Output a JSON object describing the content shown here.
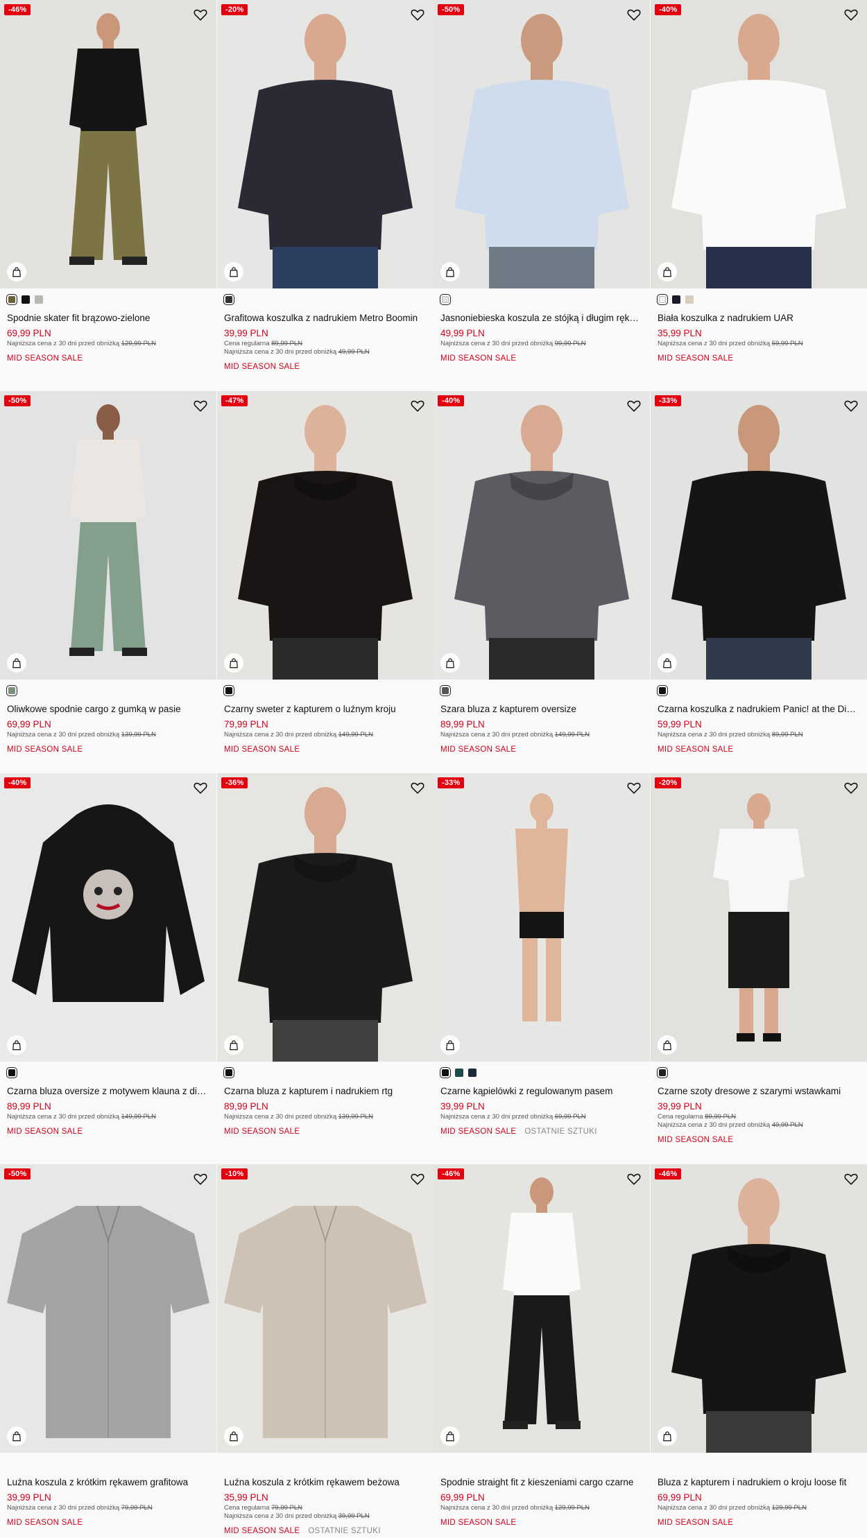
{
  "sale_tag": "MID SEASON SALE",
  "last_items_tag": "OSTATNIE SZTUKI",
  "regular_label": "Cena regularna",
  "lowest_label": "Najniższa cena z 30 dni przed obniżką",
  "products": [
    {
      "badge": "-46%",
      "name": "Spodnie skater fit brązowo-zielone",
      "price": "69,99 PLN",
      "regular": "",
      "lowest": "129,99 PLN",
      "last": false,
      "swatches": [
        "#6b6438",
        "#111111",
        "#b8b8b0"
      ]
    },
    {
      "badge": "-20%",
      "name": "Grafitowa koszulka z nadrukiem Metro Boomin",
      "price": "39,99 PLN",
      "regular": "89,99 PLN",
      "lowest": "49,99 PLN",
      "last": false,
      "swatches": [
        "#333333"
      ]
    },
    {
      "badge": "-50%",
      "name": "Jasnoniebieska koszula ze stójką i długim rękawem",
      "price": "49,99 PLN",
      "regular": "",
      "lowest": "99,99 PLN",
      "last": false,
      "swatches": [
        "#dfe4ec"
      ]
    },
    {
      "badge": "-40%",
      "name": "Biała koszulka z nadrukiem UAR",
      "price": "35,99 PLN",
      "regular": "",
      "lowest": "59,99 PLN",
      "last": false,
      "swatches": [
        "#f2f2f2",
        "#1a1a2a",
        "#d9cbbd"
      ]
    },
    {
      "badge": "-50%",
      "name": "Oliwkowe spodnie cargo z gumką w pasie",
      "price": "69,99 PLN",
      "regular": "",
      "lowest": "139,99 PLN",
      "last": false,
      "swatches": [
        "#7c917a"
      ]
    },
    {
      "badge": "-47%",
      "name": "Czarny sweter z kapturem o luźnym kroju",
      "price": "79,99 PLN",
      "regular": "",
      "lowest": "149,99 PLN",
      "last": false,
      "swatches": [
        "#111111"
      ]
    },
    {
      "badge": "-40%",
      "name": "Szara bluza z kapturem oversize",
      "price": "89,99 PLN",
      "regular": "",
      "lowest": "149,99 PLN",
      "last": false,
      "swatches": [
        "#555555"
      ]
    },
    {
      "badge": "-33%",
      "name": "Czarna koszulka z nadrukiem Panic! at the Disco",
      "price": "59,99 PLN",
      "regular": "",
      "lowest": "89,99 PLN",
      "last": false,
      "swatches": [
        "#111111"
      ]
    },
    {
      "badge": "-40%",
      "name": "Czarna bluza oversize z motywem klauna z diamencikami",
      "price": "89,99 PLN",
      "regular": "",
      "lowest": "149,99 PLN",
      "last": false,
      "swatches": [
        "#111111"
      ]
    },
    {
      "badge": "-36%",
      "name": "Czarna bluza z kapturem i nadrukiem rtg",
      "price": "89,99 PLN",
      "regular": "",
      "lowest": "139,99 PLN",
      "last": false,
      "swatches": [
        "#111111"
      ]
    },
    {
      "badge": "-33%",
      "name": "Czarne kąpielówki z regulowanym pasem",
      "price": "39,99 PLN",
      "regular": "",
      "lowest": "69,99 PLN",
      "last": true,
      "swatches": [
        "#111111",
        "#1d4a4a",
        "#1a2a3a"
      ]
    },
    {
      "badge": "-20%",
      "name": "Czarne szoty dresowe z szarymi wstawkami",
      "price": "39,99 PLN",
      "regular": "89,99 PLN",
      "lowest": "49,99 PLN",
      "last": false,
      "swatches": [
        "#222222"
      ]
    },
    {
      "badge": "-50%",
      "name": "Luźna koszula z krótkim rękawem grafitowa",
      "price": "39,99 PLN",
      "regular": "",
      "lowest": "79,99 PLN",
      "last": false,
      "swatches": []
    },
    {
      "badge": "-10%",
      "name": "Luźna koszula z krótkim rękawem beżowa",
      "price": "35,99 PLN",
      "regular": "79,99 PLN",
      "lowest": "39,99 PLN",
      "last": true,
      "swatches": []
    },
    {
      "badge": "-46%",
      "name": "Spodnie straight fit z kieszeniami cargo czarne",
      "price": "69,99 PLN",
      "regular": "",
      "lowest": "129,99 PLN",
      "last": false,
      "swatches": []
    },
    {
      "badge": "-46%",
      "name": "Bluza z kapturem i nadrukiem o kroju loose fit",
      "price": "69,99 PLN",
      "regular": "",
      "lowest": "129,99 PLN",
      "last": false,
      "swatches": []
    }
  ],
  "photo_styles": [
    {
      "bg": "#e4e2de",
      "top": "#151515",
      "bottom": "#7d7446",
      "skin": "#c9977a",
      "kind": "person-pants"
    },
    {
      "bg": "#e6e6e4",
      "top": "#2a2a35",
      "bottom": "#2c3f60",
      "skin": "#d8a98f",
      "kind": "person-tee"
    },
    {
      "bg": "#e4e4e2",
      "top": "#cfdced",
      "bottom": "#6e7a86",
      "skin": "#c99a7e",
      "kind": "person-shirt"
    },
    {
      "bg": "#e2e1dd",
      "top": "#fafafa",
      "bottom": "#27304a",
      "skin": "#d8a98f",
      "kind": "person-tee"
    },
    {
      "bg": "#e3e3e3",
      "top": "#ece6e2",
      "bottom": "#84a08c",
      "skin": "#8a5e46",
      "kind": "person-pants"
    },
    {
      "bg": "#e5e4e1",
      "top": "#181514",
      "bottom": "#2a2a2a",
      "skin": "#dcb39a",
      "kind": "person-hoodie"
    },
    {
      "bg": "#e6e6e4",
      "top": "#5c5b62",
      "bottom": "#2a2a2a",
      "skin": "#d8aa92",
      "kind": "person-hoodie"
    },
    {
      "bg": "#e2e2e0",
      "top": "#151515",
      "bottom": "#2f3a4a",
      "skin": "#c9977a",
      "kind": "person-tee"
    },
    {
      "bg": "#e9e9e7",
      "top": "#161616",
      "bottom": "#161616",
      "skin": "#e9e9e7",
      "kind": "flat-hoodie"
    },
    {
      "bg": "#e6e5e2",
      "top": "#1b1b1b",
      "bottom": "#404040",
      "skin": "#d8aa92",
      "kind": "person-hoodie"
    },
    {
      "bg": "#e6e6e4",
      "top": "#e6e6e4",
      "bottom": "#151515",
      "skin": "#e0b69b",
      "kind": "person-swim"
    },
    {
      "bg": "#e2e1dd",
      "top": "#f7f7f7",
      "bottom": "#1a1a1a",
      "skin": "#d8a98f",
      "kind": "person-shorts"
    },
    {
      "bg": "#e7e7e5",
      "top": "#a4a4a2",
      "bottom": "#a4a4a2",
      "skin": "#e7e7e5",
      "kind": "flat-shirt"
    },
    {
      "bg": "#e7e6e2",
      "top": "#cdc2b4",
      "bottom": "#cdc2b4",
      "skin": "#e7e6e2",
      "kind": "flat-shirt"
    },
    {
      "bg": "#e4e4e1",
      "top": "#fafafa",
      "bottom": "#1a1a1a",
      "skin": "#c9977a",
      "kind": "person-pants"
    },
    {
      "bg": "#e3e2df",
      "top": "#151515",
      "bottom": "#3a3a3a",
      "skin": "#dcb39a",
      "kind": "person-hoodie"
    }
  ]
}
